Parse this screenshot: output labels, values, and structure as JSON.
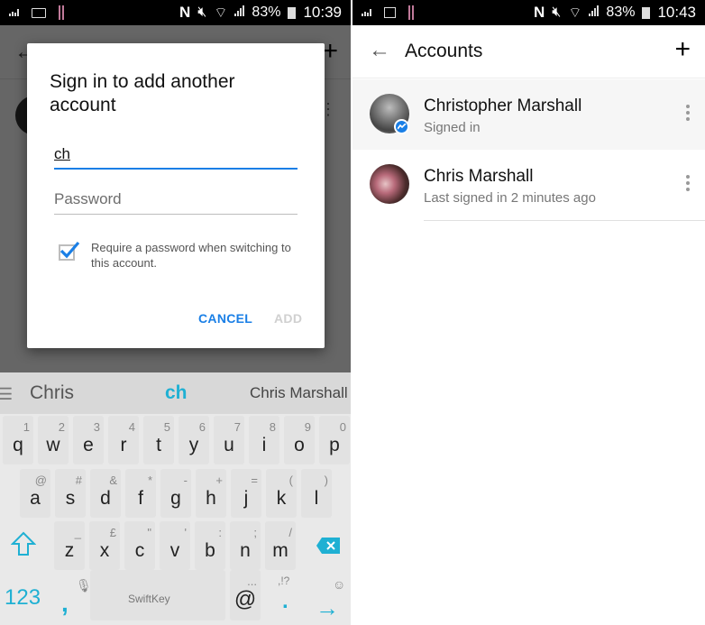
{
  "left": {
    "statusbar": {
      "battery": "83%",
      "time": "10:39"
    },
    "dialog": {
      "title": "Sign in to add another account",
      "username_value": "ch",
      "password_placeholder": "Password",
      "checkbox_checked": true,
      "checkbox_label": "Require a password when switching to this account.",
      "cancel_label": "CANCEL",
      "add_label": "ADD"
    },
    "keyboard": {
      "suggestions": [
        "Chris",
        "ch",
        "Chris Marshall"
      ],
      "row1": [
        {
          "k": "q",
          "a": "1"
        },
        {
          "k": "w",
          "a": "2"
        },
        {
          "k": "e",
          "a": "3"
        },
        {
          "k": "r",
          "a": "4"
        },
        {
          "k": "t",
          "a": "5"
        },
        {
          "k": "y",
          "a": "6"
        },
        {
          "k": "u",
          "a": "7"
        },
        {
          "k": "i",
          "a": "8"
        },
        {
          "k": "o",
          "a": "9"
        },
        {
          "k": "p",
          "a": "0"
        }
      ],
      "row2": [
        {
          "k": "a",
          "a": "@"
        },
        {
          "k": "s",
          "a": "#"
        },
        {
          "k": "d",
          "a": "&"
        },
        {
          "k": "f",
          "a": "*"
        },
        {
          "k": "g",
          "a": "-"
        },
        {
          "k": "h",
          "a": "+"
        },
        {
          "k": "j",
          "a": "="
        },
        {
          "k": "k",
          "a": "("
        },
        {
          "k": "l",
          "a": ")"
        }
      ],
      "row3": [
        {
          "k": "z",
          "a": "_"
        },
        {
          "k": "x",
          "a": "£"
        },
        {
          "k": "c",
          "a": "\""
        },
        {
          "k": "v",
          "a": "'"
        },
        {
          "k": "b",
          "a": ":"
        },
        {
          "k": "n",
          "a": ";"
        },
        {
          "k": "m",
          "a": "/"
        }
      ],
      "numbers_label": "123",
      "comma": ",",
      "space_brand": "SwiftKey",
      "at": "@",
      "at_alt": "...",
      "period": ".",
      "period_alt": ",!?",
      "accent_color": "#1fb0d3"
    }
  },
  "right": {
    "statusbar": {
      "battery": "83%",
      "time": "10:43"
    },
    "appbar": {
      "title": "Accounts"
    },
    "accounts": [
      {
        "name": "Christopher Marshall",
        "status": "Signed in",
        "active": true
      },
      {
        "name": "Chris Marshall",
        "status": "Last signed in 2 minutes ago",
        "active": false
      }
    ],
    "accent_color": "#1a7fe6"
  }
}
